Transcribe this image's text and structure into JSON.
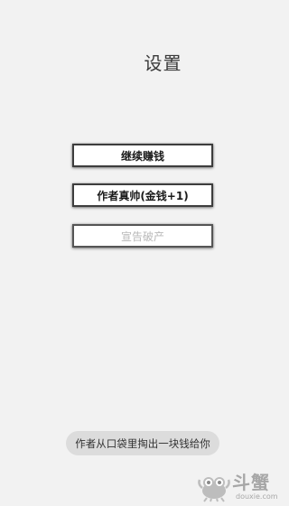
{
  "screen": {
    "title": "设置"
  },
  "menu": {
    "continue_label": "继续赚钱",
    "praise_label": "作者真帅(金钱+1)",
    "bankrupt_label": "宣告破产"
  },
  "toast": {
    "message": "作者从口袋里掏出一块钱给你"
  },
  "watermark": {
    "brand": "斗蟹",
    "url": "douxie.com",
    "icon": "crab-logo-icon"
  },
  "colors": {
    "background": "#f2f2f2",
    "button_border": "#3d3d3d",
    "disabled_text": "#b8b8b8",
    "toast_bg": "#dcdcdc"
  }
}
